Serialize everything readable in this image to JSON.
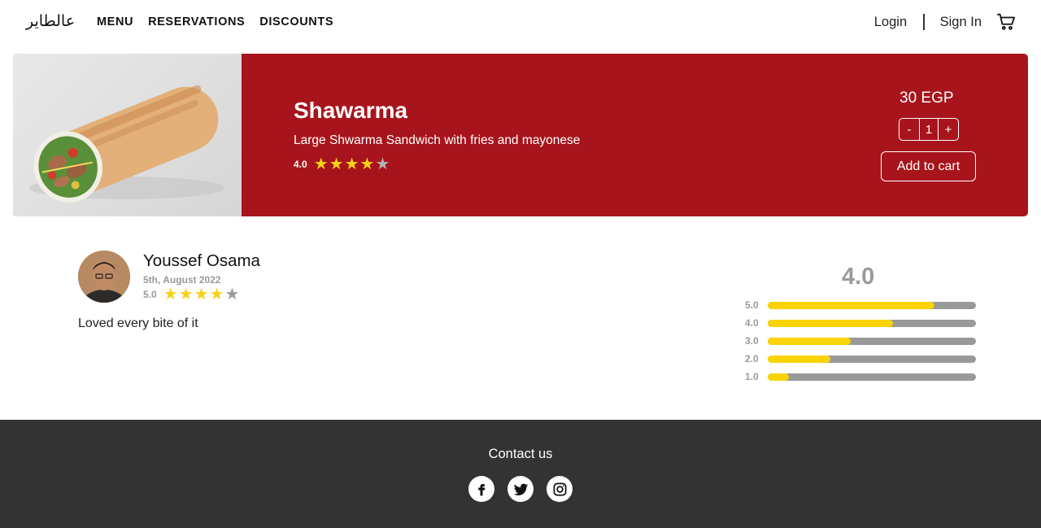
{
  "header": {
    "logo": "عالطاير",
    "nav": [
      {
        "label": "MENU"
      },
      {
        "label": "RESERVATIONS"
      },
      {
        "label": "DISCOUNTS"
      }
    ],
    "login_label": "Login",
    "signin_label": "Sign In",
    "cart_icon": "cart-icon"
  },
  "product": {
    "title": "Shawarma",
    "description": "Large Shwarma Sandwich with fries and mayonese",
    "rating_text": "4.0",
    "rating_value": 4,
    "price": "30 EGP",
    "decrement_label": "-",
    "quantity": "1",
    "increment_label": "+",
    "add_to_cart_label": "Add to cart",
    "star_on_color": "#f7d117",
    "accent_color": "#a8141c"
  },
  "review": {
    "name": "Youssef Osama",
    "date": "5th, August 2022",
    "rating_text": "5.0",
    "rating_value": 4,
    "text": "Loved every bite of it"
  },
  "distribution": {
    "average": "4.0",
    "rows": [
      {
        "label": "5.0",
        "fraction": 0.8
      },
      {
        "label": "4.0",
        "fraction": 0.6
      },
      {
        "label": "3.0",
        "fraction": 0.4
      },
      {
        "label": "2.0",
        "fraction": 0.3
      },
      {
        "label": "1.0",
        "fraction": 0.1
      }
    ],
    "fill_color": "#f9d400"
  },
  "footer": {
    "contact_label": "Contact us",
    "socials": [
      {
        "icon": "facebook-icon"
      },
      {
        "icon": "twitter-icon"
      },
      {
        "icon": "instagram-icon"
      }
    ]
  }
}
